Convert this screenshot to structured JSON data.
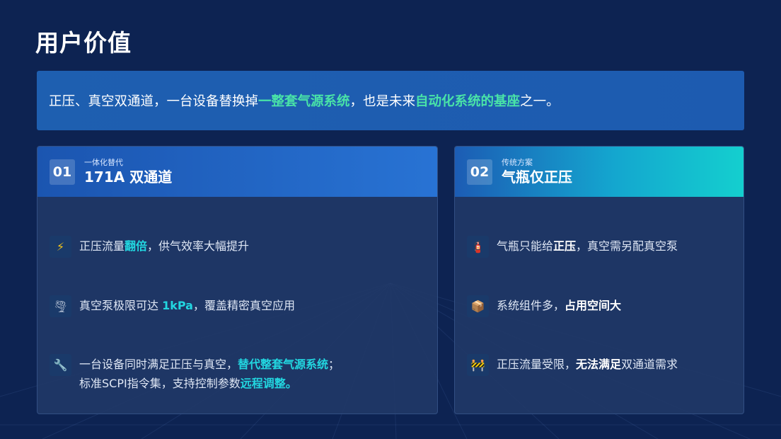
{
  "page": {
    "title": "用户价值"
  },
  "banner": {
    "part1": "正压、真空双通道，一台设备替换掉",
    "hl1": "一整套气源系统",
    "part2": "，也是未来",
    "hl2": "自动化系统的基座",
    "part3": "之一。"
  },
  "left_card": {
    "number": "01",
    "subtitle": "一体化替代",
    "title": "171A 双通道",
    "items": [
      {
        "icon": "lightning-icon",
        "glyph": "⚡",
        "pre": "正压流量",
        "hl": "翻倍",
        "post": "，供气效率大幅提升"
      },
      {
        "icon": "tornado-icon",
        "glyph": "🌪",
        "pre": "真空泵极限可达 ",
        "hl": "1kPa",
        "post": "，覆盖精密真空应用"
      },
      {
        "icon": "wrench-icon",
        "glyph": "🔧",
        "pre": "一台设备同时满足正压与真空，",
        "hl": "替代整套气源系统",
        "post": "；",
        "line2_pre": "标准SCPI指令集，支持控制参数",
        "line2_hl": "远程调整。"
      }
    ]
  },
  "right_card": {
    "number": "02",
    "subtitle": "传统方案",
    "title": "气瓶仅正压",
    "items": [
      {
        "icon": "gas-cylinder-icon",
        "glyph": "🧯",
        "pre": "气瓶只能给",
        "hl": "正压",
        "post": "，真空需另配真空泵"
      },
      {
        "icon": "package-icon",
        "glyph": "📦",
        "pre": "系统组件多，",
        "hl": "占用空间大",
        "post": ""
      },
      {
        "icon": "construction-barrier-icon",
        "glyph": "🚧",
        "pre": "正压流量受限，",
        "hl": "无法满足",
        "post": "双通道需求"
      }
    ]
  },
  "colors": {
    "background": "#0d2352",
    "banner_highlight": "#49e3a7",
    "cyan_highlight": "#22d6e0"
  }
}
